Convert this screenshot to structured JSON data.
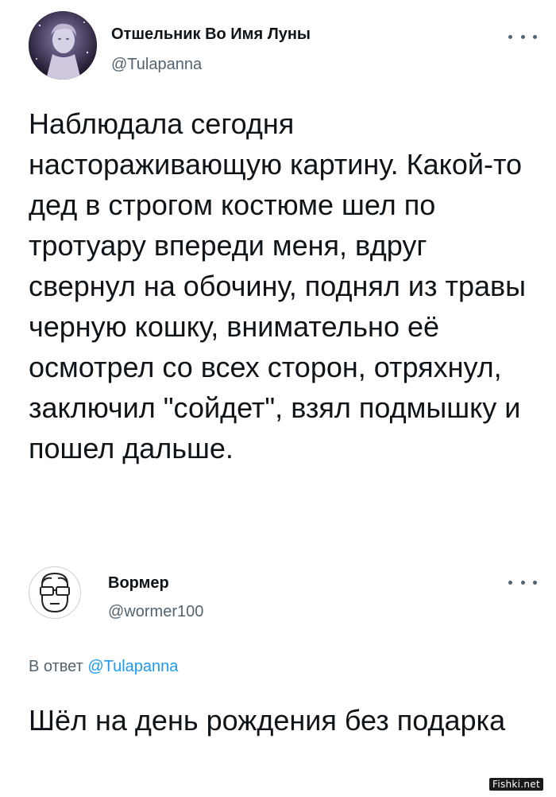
{
  "original_tweet": {
    "author_name": "Отшельник Во Имя Луны",
    "author_handle": "@Tulapanna",
    "avatar_icon": "statue-avatar-icon",
    "text": "Наблюдала сегодня настораживающую картину. Какой-то дед в строгом костюме шел по тротуару впереди меня, вдруг свернул на обочину, поднял из травы черную кошку, внимательно её осмотрел со всех сторон, отряхнул, заключил \"сойдет\", взял подмышку и пошел дальше."
  },
  "reply_tweet": {
    "author_name": "Вормер",
    "author_handle": "@wormer100",
    "avatar_icon": "glasses-face-avatar-icon",
    "reply_prefix": "В ответ",
    "reply_mention": "@Tulapanna",
    "text": "Шёл на день рождения без подарка"
  },
  "more_icon": "more-options-icon",
  "watermark": "Fishki.net",
  "colors": {
    "text": "#0f1419",
    "secondary": "#536471",
    "link": "#1d9bf0"
  }
}
